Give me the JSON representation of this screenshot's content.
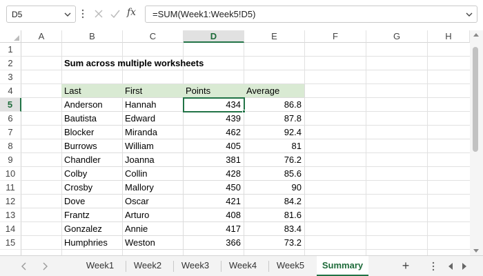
{
  "formula_bar": {
    "name_box": "D5",
    "formula": "=SUM(Week1:Week5!D5)",
    "fx_label": "fx"
  },
  "columns": [
    "A",
    "B",
    "C",
    "D",
    "E",
    "F",
    "G",
    "H"
  ],
  "selected_column": "D",
  "rows": [
    "1",
    "2",
    "3",
    "4",
    "5",
    "6",
    "7",
    "8",
    "9",
    "10",
    "11",
    "12",
    "13",
    "14",
    "15"
  ],
  "selected_row": "5",
  "sheet": {
    "title": "Sum across multiple worksheets",
    "table_headers": [
      "Last",
      "First",
      "Points",
      "Average"
    ],
    "table_rows": [
      [
        "Anderson",
        "Hannah",
        "434",
        "86.8"
      ],
      [
        "Bautista",
        "Edward",
        "439",
        "87.8"
      ],
      [
        "Blocker",
        "Miranda",
        "462",
        "92.4"
      ],
      [
        "Burrows",
        "William",
        "405",
        "81"
      ],
      [
        "Chandler",
        "Joanna",
        "381",
        "76.2"
      ],
      [
        "Colby",
        "Collin",
        "428",
        "85.6"
      ],
      [
        "Crosby",
        "Mallory",
        "450",
        "90"
      ],
      [
        "Dove",
        "Oscar",
        "421",
        "84.2"
      ],
      [
        "Frantz",
        "Arturo",
        "408",
        "81.6"
      ],
      [
        "Gonzalez",
        "Annie",
        "417",
        "83.4"
      ],
      [
        "Humphries",
        "Weston",
        "366",
        "73.2"
      ]
    ],
    "header_fill": "#d9ead3"
  },
  "tabs": [
    "Week1",
    "Week2",
    "Week3",
    "Week4",
    "Week5",
    "Summary"
  ],
  "active_tab": "Summary",
  "accent_color": "#217346"
}
